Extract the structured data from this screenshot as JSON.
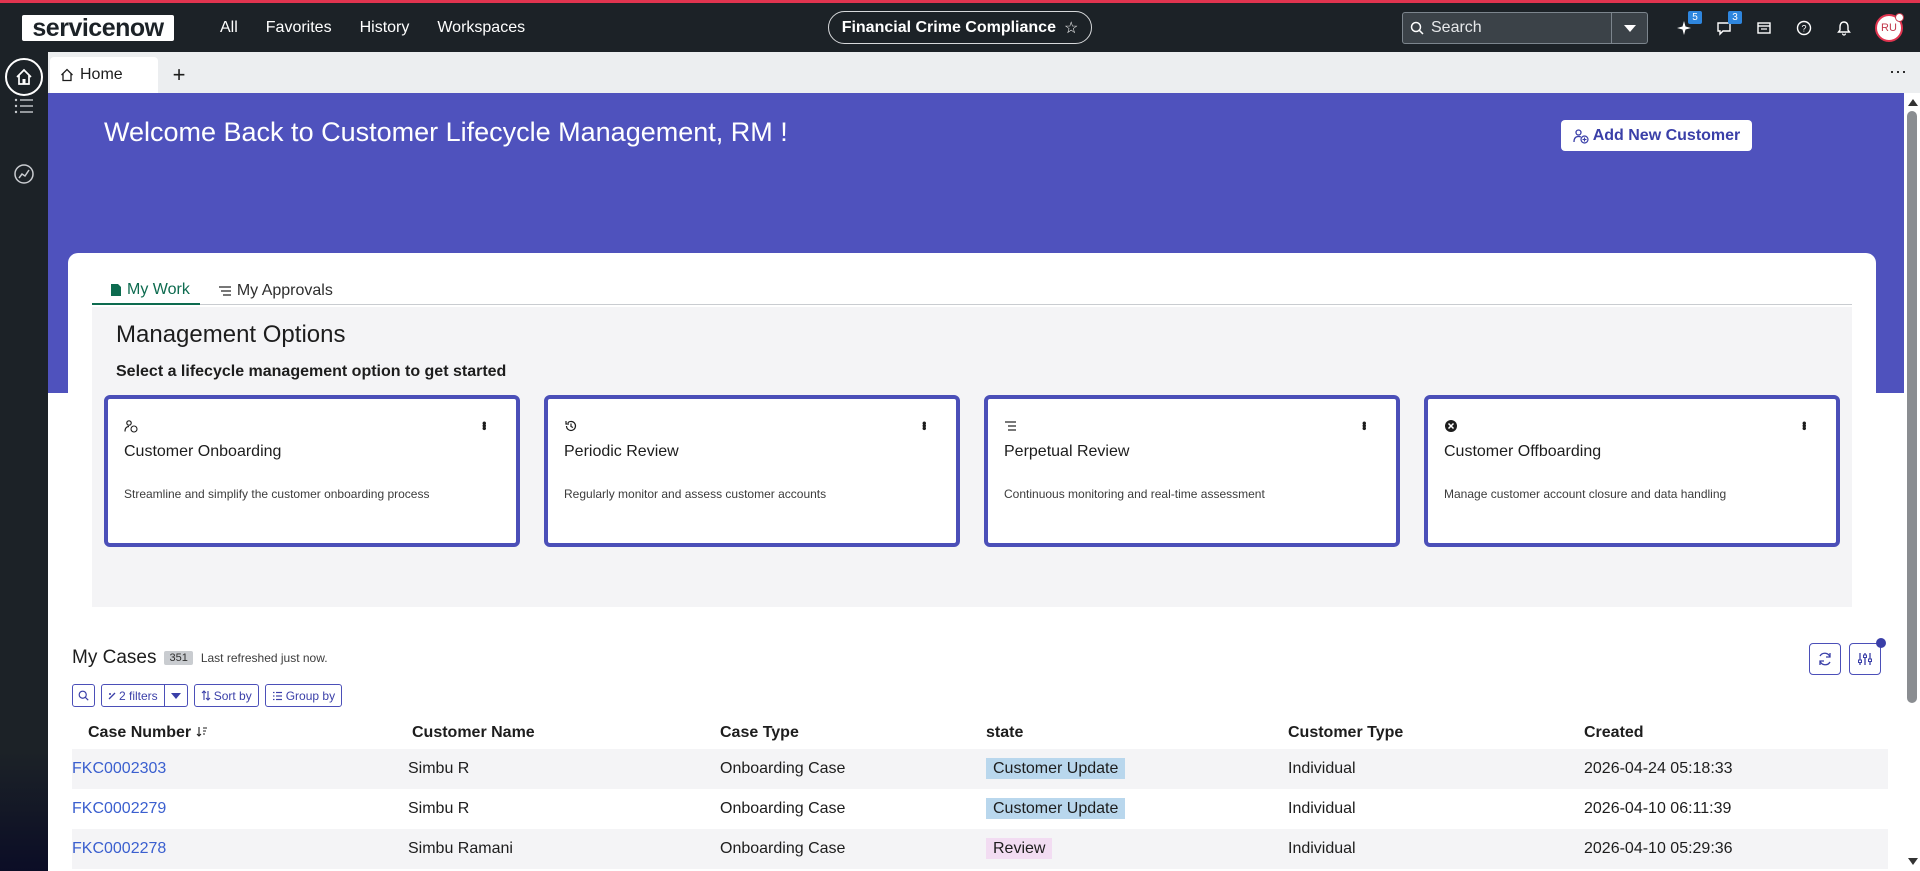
{
  "topnav": {
    "logo_text": "servicenow",
    "links": [
      "All",
      "Favorites",
      "History",
      "Workspaces"
    ],
    "scope": "Financial Crime Compliance",
    "search_placeholder": "Search",
    "badges": {
      "sparkle": "5",
      "chat": "3"
    },
    "avatar_initials": "RU"
  },
  "tabstrip": {
    "home_tab": "Home",
    "add_tab": "+",
    "more": "⋯"
  },
  "hero": {
    "title": "Welcome Back to Customer Lifecycle Management, RM !",
    "add_customer_label": "Add New Customer"
  },
  "work_tabs": [
    {
      "label": "My Work",
      "active": true
    },
    {
      "label": "My Approvals",
      "active": false
    }
  ],
  "management": {
    "title": "Management Options",
    "subtitle": "Select a lifecycle management option to get started",
    "options": [
      {
        "name": "Customer Onboarding",
        "description": "Streamline and simplify the customer onboarding process",
        "icon": "person-add-icon"
      },
      {
        "name": "Periodic Review",
        "description": "Regularly monitor and assess customer accounts",
        "icon": "history-icon"
      },
      {
        "name": "Perpetual Review",
        "description": "Continuous monitoring and real-time assessment",
        "icon": "list-sort-icon"
      },
      {
        "name": "Customer Offboarding",
        "description": "Manage customer account closure and data handling",
        "icon": "close-circle-icon"
      }
    ]
  },
  "cases": {
    "title": "My Cases",
    "count": "351",
    "refreshed": "Last refreshed just now.",
    "filters_label": "2 filters",
    "sort_label": "Sort by",
    "group_label": "Group by",
    "columns": [
      "Case Number",
      "Customer Name",
      "Case Type",
      "state",
      "Customer Type",
      "Created"
    ],
    "rows": [
      {
        "number": "FKC0002303",
        "customer": "Simbu R",
        "type": "Onboarding Case",
        "state": "Customer Update",
        "customer_type": "Individual",
        "created": "2026-04-24 05:18:33"
      },
      {
        "number": "FKC0002279",
        "customer": "Simbu R",
        "type": "Onboarding Case",
        "state": "Customer Update",
        "customer_type": "Individual",
        "created": "2026-04-10 06:11:39"
      },
      {
        "number": "FKC0002278",
        "customer": "Simbu Ramani",
        "type": "Onboarding Case",
        "state": "Review",
        "customer_type": "Individual",
        "created": "2026-04-10 05:29:36"
      }
    ]
  },
  "colors": {
    "hero_bg": "#4f52bd",
    "nav_bg": "#1c2227",
    "accent": "#e0344f",
    "active_tab": "#0d6b4f",
    "link": "#3a5fcf",
    "state_customer_update": "#b9d7ed",
    "state_review": "#f2dcf2"
  }
}
